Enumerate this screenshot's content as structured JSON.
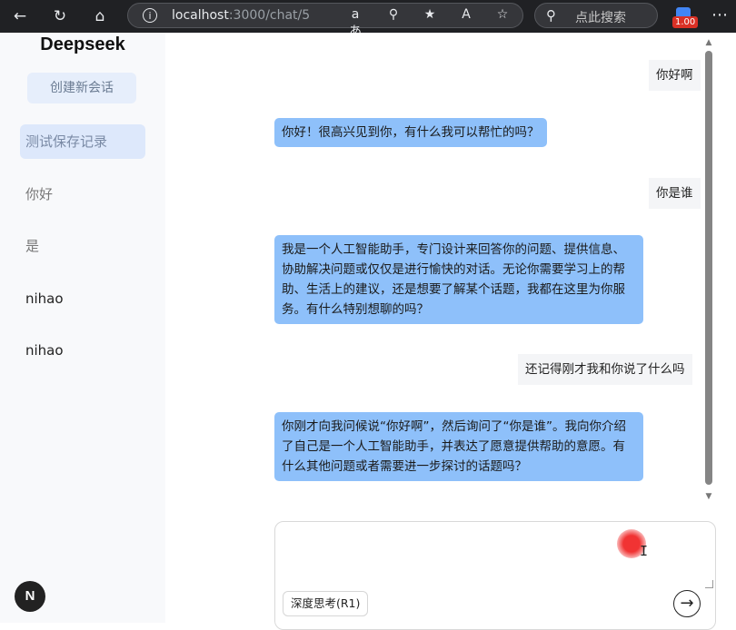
{
  "browser": {
    "url_host": "localhost",
    "url_path": ":3000/chat/5",
    "search_placeholder": "点此搜索",
    "extension_badge": "1.00",
    "read_aloud_icon": "aあ",
    "immersive_icon": "A"
  },
  "sidebar": {
    "brand": "Deepseek",
    "new_chat_label": "创建新会话",
    "conversations": [
      {
        "label": "测试保存记录"
      },
      {
        "label": "你好"
      },
      {
        "label": "是"
      },
      {
        "label": "nihao"
      },
      {
        "label": "nihao"
      }
    ],
    "avatar_letter": "N"
  },
  "messages": [
    {
      "role": "user",
      "text": "你好啊"
    },
    {
      "role": "assistant",
      "text": "你好！很高兴见到你，有什么我可以帮忙的吗？"
    },
    {
      "role": "user",
      "text": "你是谁"
    },
    {
      "role": "assistant",
      "text": "我是一个人工智能助手，专门设计来回答你的问题、提供信息、协助解决问题或仅仅是进行愉快的对话。无论你需要学习上的帮助、生活上的建议，还是想要了解某个话题，我都在这里为你服务。有什么特别想聊的吗？"
    },
    {
      "role": "user",
      "text": "还记得刚才我和你说了什么吗"
    },
    {
      "role": "assistant",
      "text": "你刚才向我问候说“你好啊”，然后询问了“你是谁”。我向你介绍了自己是一个人工智能助手，并表达了愿意提供帮助的意愿。有什么其他问题或者需要进一步探讨的话题吗？"
    }
  ],
  "composer": {
    "value": "",
    "deep_think_label": "深度思考(R1)",
    "send_icon": "→"
  },
  "colors": {
    "assistant_bubble": "#8ec0fa",
    "user_bubble": "#f4f5f7",
    "active_conversation": "#dde8fb",
    "new_chat_button": "#e6eefb"
  }
}
